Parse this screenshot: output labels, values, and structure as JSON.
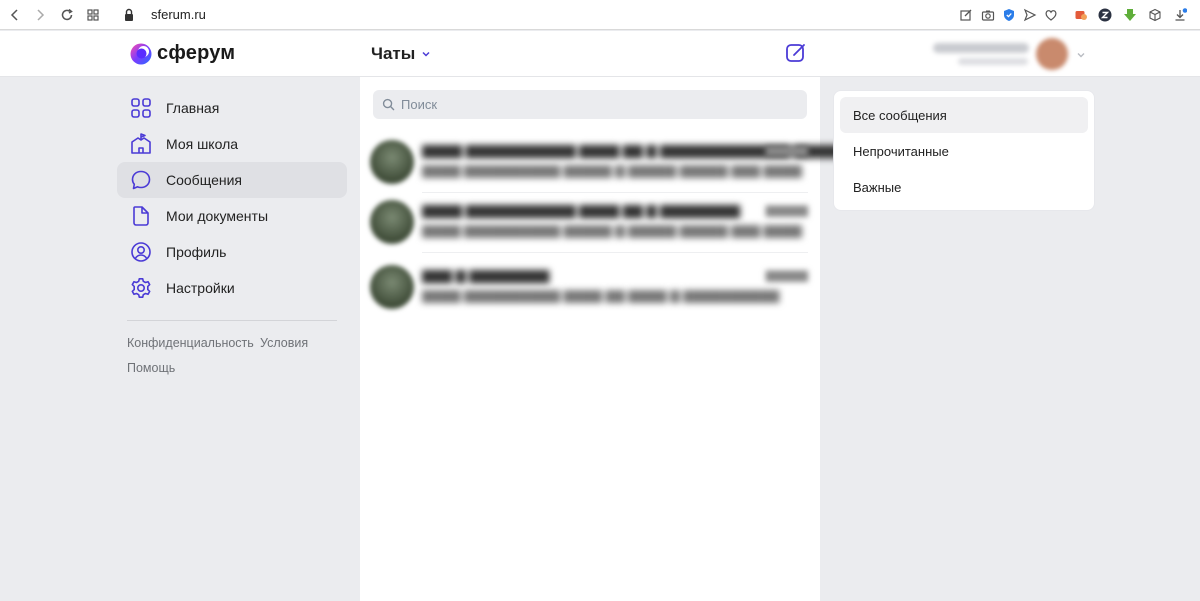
{
  "browser": {
    "url": "sferum.ru"
  },
  "header": {
    "logo_text": "сферум",
    "chats_title": "Чаты"
  },
  "sidebar": {
    "items": [
      {
        "label": "Главная",
        "icon": "grid-icon"
      },
      {
        "label": "Моя школа",
        "icon": "school-icon"
      },
      {
        "label": "Сообщения",
        "icon": "message-icon",
        "active": true
      },
      {
        "label": "Мои документы",
        "icon": "document-icon"
      },
      {
        "label": "Профиль",
        "icon": "profile-icon"
      },
      {
        "label": "Настройки",
        "icon": "gear-icon"
      }
    ],
    "footer": {
      "privacy": "Конфиденциальность",
      "terms": "Условия",
      "help": "Помощь"
    }
  },
  "chats": {
    "search_placeholder": "Поиск"
  },
  "filters": {
    "items": [
      {
        "label": "Все сообщения",
        "active": true
      },
      {
        "label": "Непрочитанные"
      },
      {
        "label": "Важные"
      }
    ]
  },
  "colors": {
    "accent": "#4b3bd6",
    "background": "#ebecef"
  }
}
